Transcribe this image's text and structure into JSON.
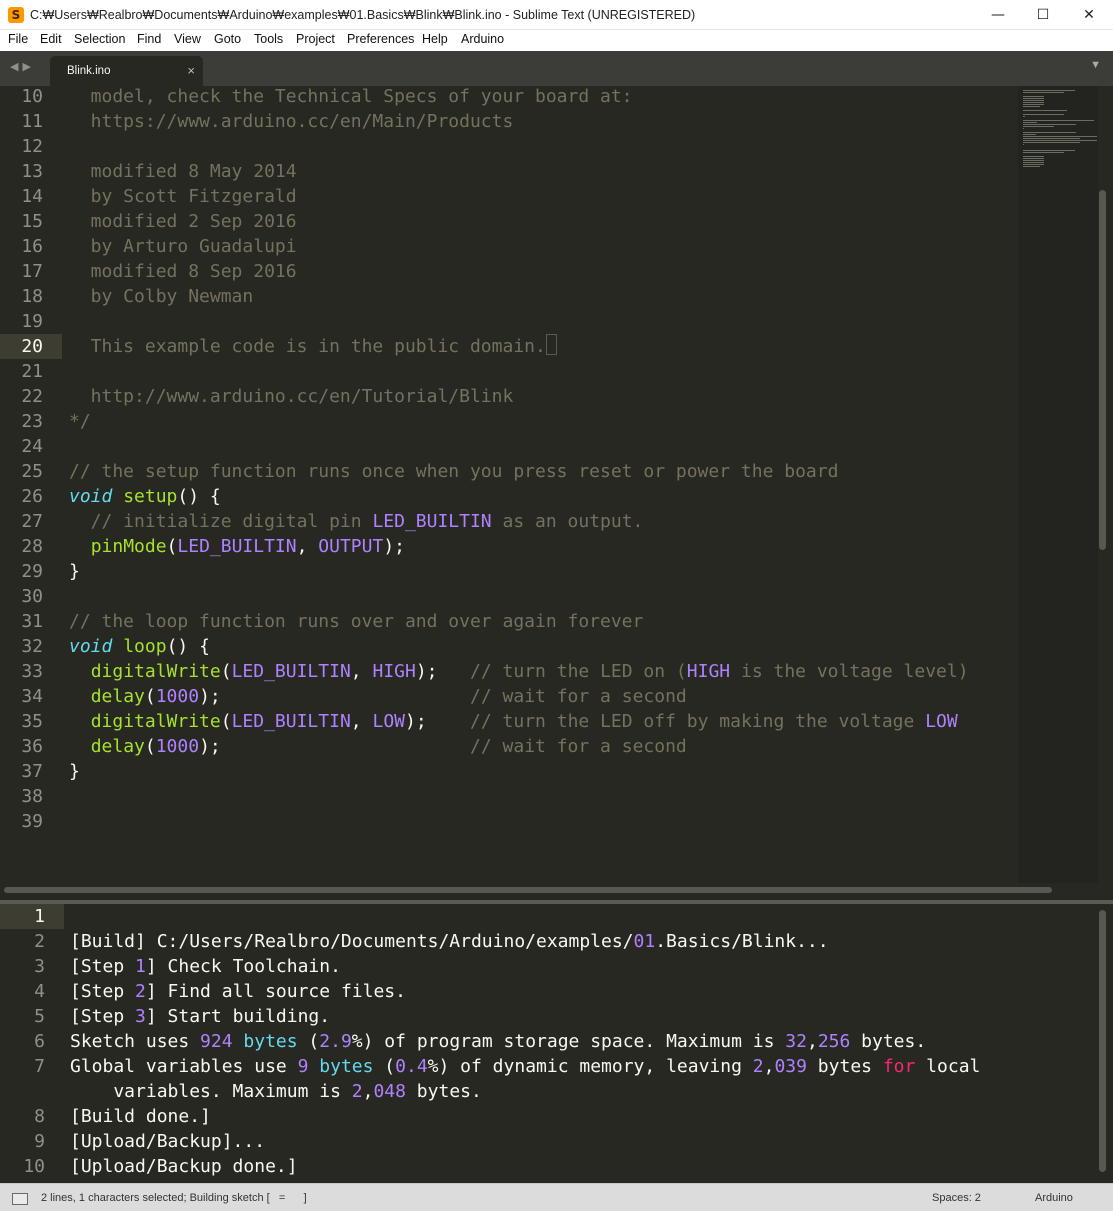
{
  "window": {
    "title": "C:₩Users₩Realbro₩Documents₩Arduino₩examples₩01.Basics₩Blink₩Blink.ino - Sublime Text (UNREGISTERED)",
    "app_icon_glyph": "S",
    "minimize_glyph": "—",
    "maximize_glyph": "☐",
    "close_glyph": "✕"
  },
  "menu": [
    "File",
    "Edit",
    "Selection",
    "Find",
    "View",
    "Goto",
    "Tools",
    "Project",
    "Preferences",
    "Help",
    "Arduino"
  ],
  "tabs": {
    "nav_glyph": "◀▶",
    "active_tab": "Blink.ino",
    "close_glyph": "×",
    "dropdown_glyph": "▼"
  },
  "editor": {
    "active_line": "20",
    "lines": [
      {
        "n": "10",
        "segs": [
          {
            "t": "  model, check the Technical Specs of your board at:",
            "c": "cmt"
          }
        ]
      },
      {
        "n": "11",
        "segs": [
          {
            "t": "  https://www.arduino.cc/en/Main/Products",
            "c": "cmt"
          }
        ]
      },
      {
        "n": "12",
        "segs": []
      },
      {
        "n": "13",
        "segs": [
          {
            "t": "  modified 8 May 2014",
            "c": "cmt"
          }
        ]
      },
      {
        "n": "14",
        "segs": [
          {
            "t": "  by Scott Fitzgerald",
            "c": "cmt"
          }
        ]
      },
      {
        "n": "15",
        "segs": [
          {
            "t": "  modified 2 Sep 2016",
            "c": "cmt"
          }
        ]
      },
      {
        "n": "16",
        "segs": [
          {
            "t": "  by Arturo Guadalupi",
            "c": "cmt"
          }
        ]
      },
      {
        "n": "17",
        "segs": [
          {
            "t": "  modified 8 Sep 2016",
            "c": "cmt"
          }
        ]
      },
      {
        "n": "18",
        "segs": [
          {
            "t": "  by Colby Newman",
            "c": "cmt"
          }
        ]
      },
      {
        "n": "19",
        "segs": []
      },
      {
        "n": "20",
        "segs": [
          {
            "t": "  This example code is in the public domain.",
            "c": "cmt"
          }
        ],
        "cursor": true
      },
      {
        "n": "21",
        "segs": []
      },
      {
        "n": "22",
        "segs": [
          {
            "t": "  http://www.arduino.cc/en/Tutorial/Blink",
            "c": "cmt"
          }
        ]
      },
      {
        "n": "23",
        "segs": [
          {
            "t": "*/",
            "c": "cmt"
          }
        ]
      },
      {
        "n": "24",
        "segs": []
      },
      {
        "n": "25",
        "segs": [
          {
            "t": "// the setup function runs once when you press reset or power the board",
            "c": "cmt"
          }
        ]
      },
      {
        "n": "26",
        "segs": [
          {
            "t": "void",
            "c": "kw"
          },
          {
            "t": " ",
            "c": "plain"
          },
          {
            "t": "setup",
            "c": "fn"
          },
          {
            "t": "() {",
            "c": "plain"
          }
        ]
      },
      {
        "n": "27",
        "segs": [
          {
            "t": "  // initialize digital pin ",
            "c": "cmt"
          },
          {
            "t": "LED_BUILTIN",
            "c": "cst"
          },
          {
            "t": " as an output.",
            "c": "cmt"
          }
        ]
      },
      {
        "n": "28",
        "segs": [
          {
            "t": "  ",
            "c": "plain"
          },
          {
            "t": "pinMode",
            "c": "fn"
          },
          {
            "t": "(",
            "c": "plain"
          },
          {
            "t": "LED_BUILTIN",
            "c": "cst"
          },
          {
            "t": ", ",
            "c": "plain"
          },
          {
            "t": "OUTPUT",
            "c": "cst"
          },
          {
            "t": ");",
            "c": "plain"
          }
        ]
      },
      {
        "n": "29",
        "segs": [
          {
            "t": "}",
            "c": "plain"
          }
        ]
      },
      {
        "n": "30",
        "segs": []
      },
      {
        "n": "31",
        "segs": [
          {
            "t": "// the loop function runs over and over again forever",
            "c": "cmt"
          }
        ]
      },
      {
        "n": "32",
        "segs": [
          {
            "t": "void",
            "c": "kw"
          },
          {
            "t": " ",
            "c": "plain"
          },
          {
            "t": "loop",
            "c": "fn"
          },
          {
            "t": "() {",
            "c": "plain"
          }
        ]
      },
      {
        "n": "33",
        "segs": [
          {
            "t": "  ",
            "c": "plain"
          },
          {
            "t": "digitalWrite",
            "c": "fn"
          },
          {
            "t": "(",
            "c": "plain"
          },
          {
            "t": "LED_BUILTIN",
            "c": "cst"
          },
          {
            "t": ", ",
            "c": "plain"
          },
          {
            "t": "HIGH",
            "c": "cst"
          },
          {
            "t": ");   ",
            "c": "plain"
          },
          {
            "t": "// turn the LED on (",
            "c": "cmt"
          },
          {
            "t": "HIGH",
            "c": "cst"
          },
          {
            "t": " is the voltage level)",
            "c": "cmt"
          }
        ]
      },
      {
        "n": "34",
        "segs": [
          {
            "t": "  ",
            "c": "plain"
          },
          {
            "t": "delay",
            "c": "fn"
          },
          {
            "t": "(",
            "c": "plain"
          },
          {
            "t": "1000",
            "c": "num"
          },
          {
            "t": ");                       ",
            "c": "plain"
          },
          {
            "t": "// wait for a second",
            "c": "cmt"
          }
        ]
      },
      {
        "n": "35",
        "segs": [
          {
            "t": "  ",
            "c": "plain"
          },
          {
            "t": "digitalWrite",
            "c": "fn"
          },
          {
            "t": "(",
            "c": "plain"
          },
          {
            "t": "LED_BUILTIN",
            "c": "cst"
          },
          {
            "t": ", ",
            "c": "plain"
          },
          {
            "t": "LOW",
            "c": "cst"
          },
          {
            "t": ");    ",
            "c": "plain"
          },
          {
            "t": "// turn the LED off by making the voltage ",
            "c": "cmt"
          },
          {
            "t": "LOW",
            "c": "cst"
          }
        ]
      },
      {
        "n": "36",
        "segs": [
          {
            "t": "  ",
            "c": "plain"
          },
          {
            "t": "delay",
            "c": "fn"
          },
          {
            "t": "(",
            "c": "plain"
          },
          {
            "t": "1000",
            "c": "num"
          },
          {
            "t": ");                       ",
            "c": "plain"
          },
          {
            "t": "// wait for a second",
            "c": "cmt"
          }
        ]
      },
      {
        "n": "37",
        "segs": [
          {
            "t": "}",
            "c": "plain"
          }
        ]
      },
      {
        "n": "38",
        "segs": []
      },
      {
        "n": "39",
        "segs": []
      }
    ]
  },
  "output_panel": {
    "lines": [
      {
        "n": "1",
        "segs": [],
        "active": true
      },
      {
        "n": "2",
        "segs": [
          {
            "t": "[Build] C:/Users/Realbro/Documents/Arduino/examples/",
            "c": "plain"
          },
          {
            "t": "01",
            "c": "num"
          },
          {
            "t": ".Basics/Blink...",
            "c": "plain"
          }
        ]
      },
      {
        "n": "3",
        "segs": [
          {
            "t": "[Step ",
            "c": "plain"
          },
          {
            "t": "1",
            "c": "num"
          },
          {
            "t": "] Check Toolchain.",
            "c": "plain"
          }
        ]
      },
      {
        "n": "4",
        "segs": [
          {
            "t": "[Step ",
            "c": "plain"
          },
          {
            "t": "2",
            "c": "num"
          },
          {
            "t": "] Find all source files.",
            "c": "plain"
          }
        ]
      },
      {
        "n": "5",
        "segs": [
          {
            "t": "[Step ",
            "c": "plain"
          },
          {
            "t": "3",
            "c": "num"
          },
          {
            "t": "] Start building.",
            "c": "plain"
          }
        ]
      },
      {
        "n": "6",
        "segs": [
          {
            "t": "Sketch uses ",
            "c": "plain"
          },
          {
            "t": "924",
            "c": "num"
          },
          {
            "t": " ",
            "c": "plain"
          },
          {
            "t": "bytes",
            "c": "kwp"
          },
          {
            "t": " (",
            "c": "plain"
          },
          {
            "t": "2.9",
            "c": "num"
          },
          {
            "t": "%) of program storage space. Maximum is ",
            "c": "plain"
          },
          {
            "t": "32",
            "c": "num"
          },
          {
            "t": ",",
            "c": "plain"
          },
          {
            "t": "256",
            "c": "num"
          },
          {
            "t": " bytes.",
            "c": "plain"
          }
        ]
      },
      {
        "n": "7",
        "segs": [
          {
            "t": "Global variables use ",
            "c": "plain"
          },
          {
            "t": "9",
            "c": "num"
          },
          {
            "t": " ",
            "c": "plain"
          },
          {
            "t": "bytes",
            "c": "kwp"
          },
          {
            "t": " (",
            "c": "plain"
          },
          {
            "t": "0.4",
            "c": "num"
          },
          {
            "t": "%) of dynamic memory, leaving ",
            "c": "plain"
          },
          {
            "t": "2",
            "c": "num"
          },
          {
            "t": ",",
            "c": "plain"
          },
          {
            "t": "039",
            "c": "num"
          },
          {
            "t": " bytes ",
            "c": "plain"
          },
          {
            "t": "for",
            "c": "red"
          },
          {
            "t": " local",
            "c": "plain"
          }
        ]
      },
      {
        "n": "",
        "segs": [
          {
            "t": "    variables. Maximum is ",
            "c": "plain"
          },
          {
            "t": "2",
            "c": "num"
          },
          {
            "t": ",",
            "c": "plain"
          },
          {
            "t": "048",
            "c": "num"
          },
          {
            "t": " bytes.",
            "c": "plain"
          }
        ]
      },
      {
        "n": "8",
        "segs": [
          {
            "t": "[Build done.]",
            "c": "plain"
          }
        ]
      },
      {
        "n": "9",
        "segs": [
          {
            "t": "[Upload/Backup]...",
            "c": "plain"
          }
        ]
      },
      {
        "n": "10",
        "segs": [
          {
            "t": "[Upload/Backup done.]",
            "c": "plain"
          }
        ]
      }
    ]
  },
  "status": {
    "left": "2 lines, 1 characters selected; Building sketch [   =      ]",
    "spaces": "Spaces: 2",
    "syntax": "Arduino"
  },
  "colors": {
    "background": "#272822",
    "comment": "#75715e",
    "keyword": "#66d9ef",
    "function": "#a6e22e",
    "constant": "#ae81ff",
    "text": "#f8f8f2",
    "red_keyword": "#f92672"
  }
}
